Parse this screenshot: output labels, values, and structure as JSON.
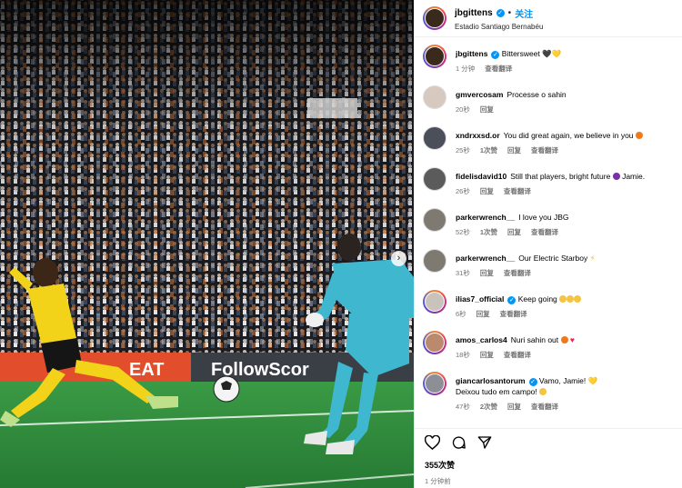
{
  "post": {
    "username": "jbgittens",
    "dot": "•",
    "follow_label": "关注",
    "location": "Estadio Santiago Bernabéu",
    "likes": "355次赞",
    "time_ago": "1 分钟前"
  },
  "photo": {
    "banner_left": "EAT",
    "banner_right": "FollowScor"
  },
  "caption": {
    "username": "jbgittens",
    "text": "Bittersweet",
    "time": "1 分钟",
    "translate": "查看翻译"
  },
  "comments": [
    {
      "username": "gmvercosam",
      "text": "Processe o sahin",
      "time": "20秒",
      "likes": "",
      "reply": "回复",
      "translate": ""
    },
    {
      "username": "xndrxxsd.or",
      "text": "You did great again, we believe in you",
      "time": "25秒",
      "likes": "1次赞",
      "reply": "回复",
      "translate": "查看翻译"
    },
    {
      "username": "fidelisdavid10",
      "text": "Still that players, bright future",
      "text2": "Jamie.",
      "time": "26秒",
      "likes": "",
      "reply": "回复",
      "translate": "查看翻译"
    },
    {
      "username": "parkerwrench__",
      "text": "I love you JBG",
      "time": "52秒",
      "likes": "1次赞",
      "reply": "回复",
      "translate": "查看翻译"
    },
    {
      "username": "parkerwrench__",
      "text": "Our Electric Starboy",
      "time": "31秒",
      "likes": "",
      "reply": "回复",
      "translate": "查看翻译"
    },
    {
      "username": "ilias7_official",
      "text": "Keep going",
      "time": "6秒",
      "likes": "",
      "reply": "回复",
      "translate": "查看翻译"
    },
    {
      "username": "amos_carlos4",
      "text": "Nuri sahin out",
      "time": "18秒",
      "likes": "",
      "reply": "回复",
      "translate": "查看翻译"
    },
    {
      "username": "giancarlosantorum",
      "text": "Vamo, Jamie!",
      "text2": "Deixou tudo em campo!",
      "time": "47秒",
      "likes": "2次赞",
      "reply": "回复",
      "translate": "查看翻译"
    }
  ],
  "icons": {
    "like": "heart-icon",
    "comment": "comment-icon",
    "share": "share-icon",
    "next": "chevron-right-icon",
    "verified": "verified-badge-icon"
  },
  "colors": {
    "link_blue": "#0095f6",
    "muted_text": "#737373",
    "pitch_green": "#2f8a3c",
    "dortmund_yellow": "#f2d31a",
    "keeper_cyan": "#3fb7cf"
  }
}
